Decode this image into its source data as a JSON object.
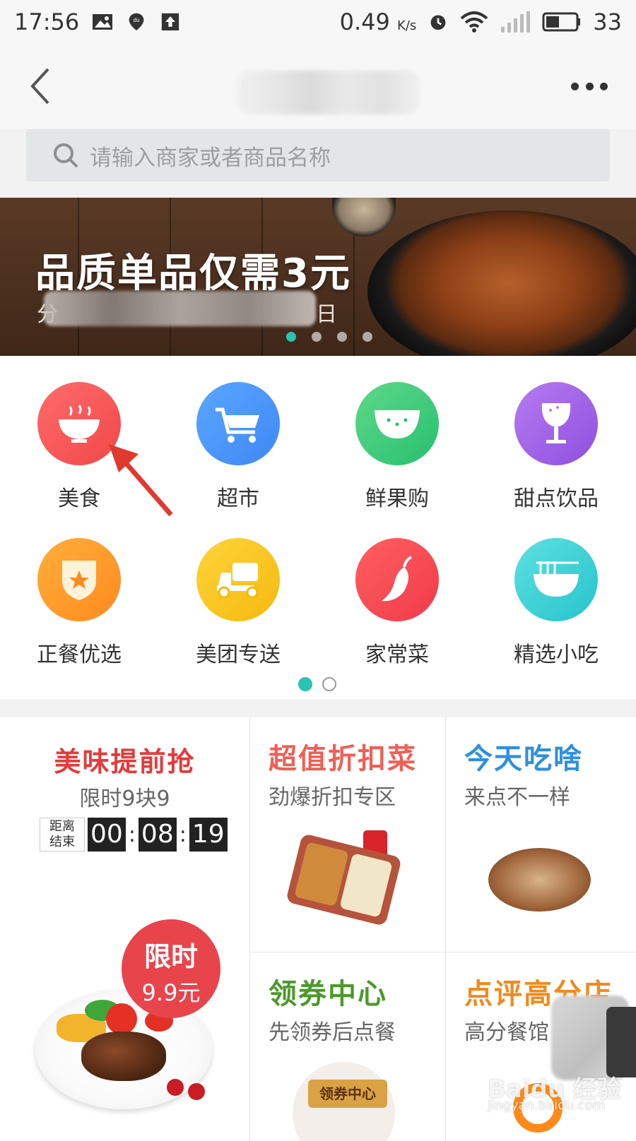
{
  "status_bar": {
    "time": "17:56",
    "net_speed": "0.49",
    "net_unit": "K/s",
    "battery": "33",
    "left_icons": [
      "image-icon",
      "baidu-map-pin-icon",
      "upload-icon"
    ],
    "right_icons": [
      "alarm-icon",
      "wifi-icon",
      "signal-icon",
      "battery-icon"
    ]
  },
  "nav": {
    "back_icon": "chevron-left-icon",
    "more_icon": "more-dots-icon"
  },
  "search": {
    "placeholder": "请输入商家或者商品名称",
    "icon": "search-icon"
  },
  "banner": {
    "title": "品质单品仅需3元",
    "subtitle_left": "分",
    "subtitle_right": "日",
    "slide_count": 5,
    "active_slide": 0
  },
  "categories": {
    "rows": [
      [
        {
          "label": "美食",
          "icon": "bowl-icon",
          "color_from": "#ff6b6b",
          "color_to": "#f04848"
        },
        {
          "label": "超市",
          "icon": "cart-icon",
          "color_from": "#5aa7ff",
          "color_to": "#3f87f5"
        },
        {
          "label": "鲜果购",
          "icon": "watermelon-icon",
          "color_from": "#5fd98a",
          "color_to": "#27bf6f"
        },
        {
          "label": "甜点饮品",
          "icon": "wine-glass-icon",
          "color_from": "#b57cf0",
          "color_to": "#8f4fe0"
        }
      ],
      [
        {
          "label": "正餐优选",
          "icon": "star-shield-icon",
          "color_from": "#ffae3a",
          "color_to": "#ff8a1f"
        },
        {
          "label": "美团专送",
          "icon": "scooter-icon",
          "color_from": "#ffd43a",
          "color_to": "#f5b90f"
        },
        {
          "label": "家常菜",
          "icon": "chili-icon",
          "color_from": "#ff6060",
          "color_to": "#ef3a4a"
        },
        {
          "label": "精选小吃",
          "icon": "noodle-bowl-icon",
          "color_from": "#5ee0e0",
          "color_to": "#25c4cc"
        }
      ]
    ],
    "page_count": 2,
    "active_page": 0
  },
  "promo": {
    "flash": {
      "title": "美味提前抢",
      "subtitle": "限时9块9",
      "countdown_label_line1": "距离",
      "countdown_label_line2": "结束",
      "hours": "00",
      "minutes": "08",
      "seconds": "19",
      "badge_line1": "限时",
      "badge_line2": "9.9元",
      "title_color": "#e33b3b"
    },
    "discount": {
      "title": "超值折扣菜",
      "subtitle": "劲爆折扣专区",
      "title_color": "#ef5f55"
    },
    "today": {
      "title": "今天吃啥",
      "subtitle": "来点不一样",
      "title_color": "#2d8fe0"
    },
    "coupon": {
      "title": "领券中心",
      "subtitle": "先领券后点餐",
      "tag": "领券中心",
      "title_color": "#4c9a2a"
    },
    "rated": {
      "title": "点评高分店",
      "subtitle": "高分餐馆",
      "title_color": "#f08a1c"
    }
  },
  "watermark": {
    "line1": "Baidu 经验",
    "line2": "jingyan.baidu.com"
  }
}
